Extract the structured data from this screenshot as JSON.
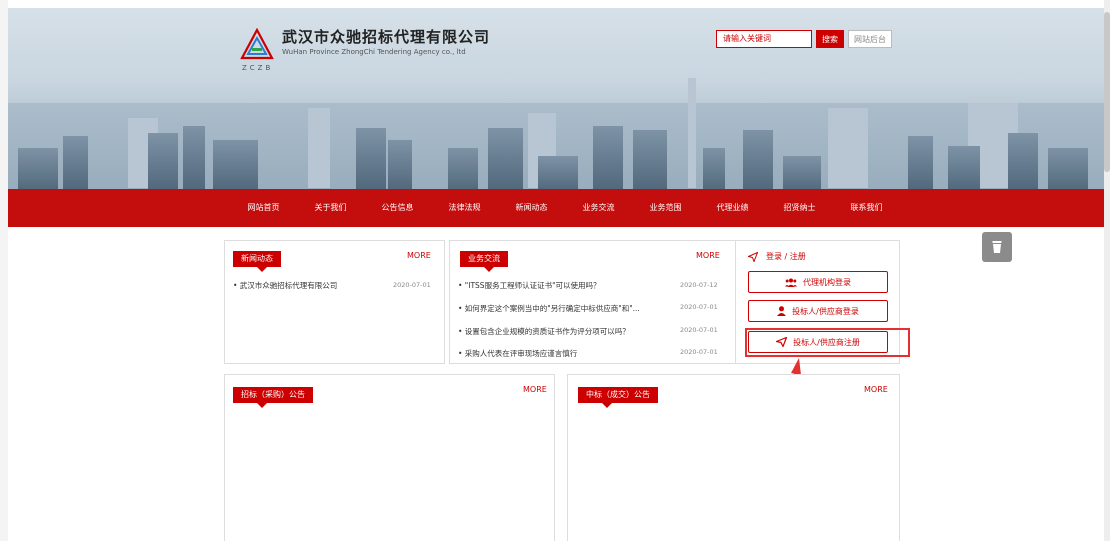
{
  "header": {
    "company_name": "武汉市众驰招标代理有限公司",
    "company_en": "WuHan Province ZhongChi Tendering Agency co., ltd",
    "logo_letters": "ZCZB",
    "search_placeholder": "请输入关键词",
    "search_label": "搜索",
    "admin_label": "网站后台"
  },
  "nav": {
    "items": [
      "网站首页",
      "关于我们",
      "公告信息",
      "法律法规",
      "新闻动态",
      "业务交流",
      "业务范围",
      "代理业绩",
      "招贤纳士",
      "联系我们"
    ]
  },
  "news": {
    "title": "新闻动态",
    "more": "MORE",
    "items": [
      {
        "text": "• 武汉市众驰招标代理有限公司",
        "date": "2020-07-01"
      }
    ]
  },
  "business": {
    "title": "业务交流",
    "more": "MORE",
    "items": [
      {
        "text": "• \"ITSS服务工程师认证证书\"可以使用吗？",
        "date": "2020-07-12"
      },
      {
        "text": "• 如何界定这个案例当中的\"另行确定中标供应商\"和\"...",
        "date": "2020-07-01"
      },
      {
        "text": "• 设置包含企业规模的资质证书作为评分项可以吗？",
        "date": "2020-07-01"
      },
      {
        "text": "• 采购人代表在评审现场应谨言慎行",
        "date": "2020-07-01"
      }
    ]
  },
  "login": {
    "title": "登录 / 注册",
    "agency_login": "代理机构登录",
    "bidder_login": "投标人/供应商登录",
    "bidder_register": "投标人/供应商注册"
  },
  "tender": {
    "title": "招标（采购）公告",
    "more": "MORE"
  },
  "award": {
    "title": "中标（成交）公告",
    "more": "MORE"
  },
  "colors": {
    "brand_red": "#c40d0d",
    "highlight": "#e53030"
  }
}
